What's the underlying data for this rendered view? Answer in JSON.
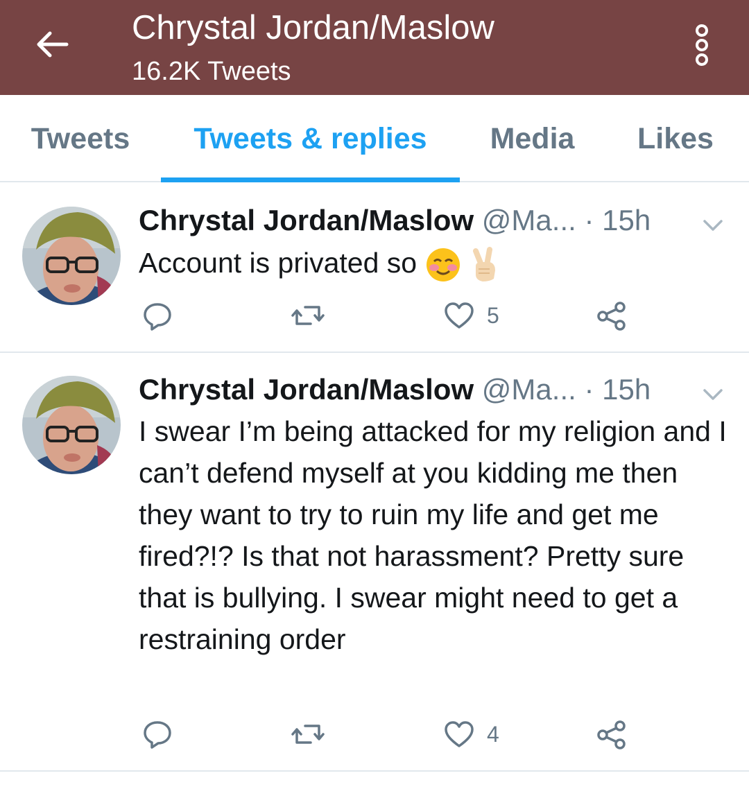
{
  "header": {
    "title": "Chrystal Jordan/Maslow",
    "subtitle": "16.2K Tweets",
    "back_icon": "arrow-left-icon",
    "more_icon": "more-vertical-icon",
    "background_color": "#774444"
  },
  "tabs": [
    {
      "label": "Tweets",
      "active": false
    },
    {
      "label": "Tweets & replies",
      "active": true
    },
    {
      "label": "Media",
      "active": false
    },
    {
      "label": "Likes",
      "active": false
    }
  ],
  "accent_color": "#1da1f2",
  "tweets": [
    {
      "name": "Chrystal Jordan/Maslow",
      "handle": "@Ma...",
      "separator": "·",
      "time": "15h",
      "text": "Account is privated so",
      "emojis": [
        "smiling-face-with-blush-icon",
        "victory-hand-icon"
      ],
      "likes": "5"
    },
    {
      "name": "Chrystal Jordan/Maslow",
      "handle": "@Ma...",
      "separator": "·",
      "time": "15h",
      "text": "I swear I’m being attacked for my religion and I can’t defend myself at you kidding me then they want to try to ruin my life and get me fired?!? Is that not harassment? Pretty sure that is bullying. I swear might need to get a restraining order",
      "likes": "4"
    }
  ]
}
